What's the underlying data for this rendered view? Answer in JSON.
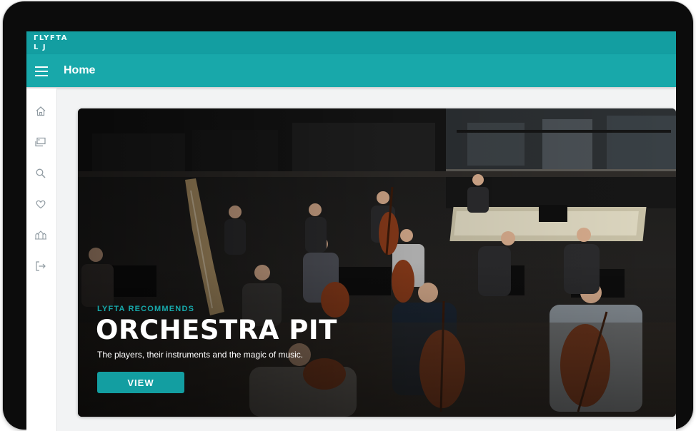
{
  "brand": {
    "logo_line1": "ΓLYFTA",
    "logo_line2": "L J"
  },
  "header": {
    "menu_icon": "hamburger-menu-icon",
    "title": "Home"
  },
  "sidebar": {
    "items": [
      {
        "icon": "home-icon"
      },
      {
        "icon": "lessons-icon"
      },
      {
        "icon": "search-icon"
      },
      {
        "icon": "heart-icon"
      },
      {
        "icon": "world-icon"
      },
      {
        "icon": "logout-icon"
      }
    ]
  },
  "hero": {
    "eyebrow": "LYFTA RECOMMENDS",
    "title": "ORCHESTRA PIT",
    "subtitle": "The players, their instruments and the magic of music.",
    "button_label": "VIEW"
  },
  "colors": {
    "brand": "#139ea1",
    "topbar": "#18a8aa",
    "accent_text": "#17a9ab"
  }
}
